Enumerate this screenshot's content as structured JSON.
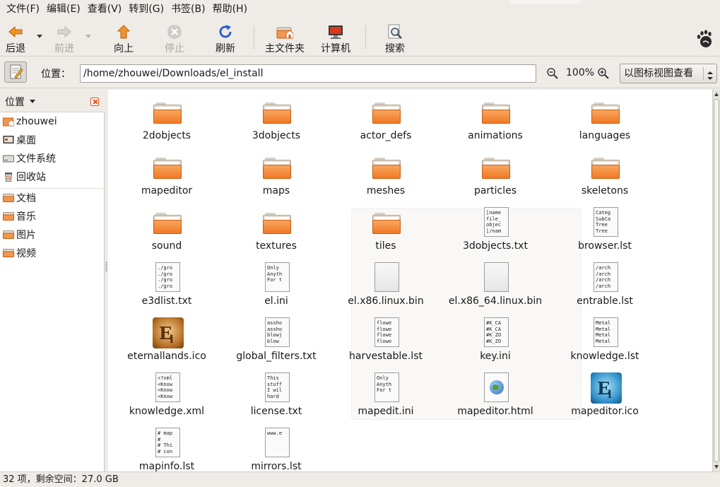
{
  "menubar": {
    "items": [
      "文件(F)",
      "编辑(E)",
      "查看(V)",
      "转到(G)",
      "书签(B)",
      "帮助(H)"
    ]
  },
  "toolbar": {
    "back": "后退",
    "forward": "前进",
    "up": "向上",
    "stop": "停止",
    "reload": "刷新",
    "home": "主文件夹",
    "computer": "计算机",
    "search": "搜索"
  },
  "location": {
    "label": "位置：",
    "path": "/home/zhouwei/Downloads/el_install",
    "zoom": "100%",
    "view_mode": "以图标视图查看"
  },
  "sidebar": {
    "title": "位置",
    "items": [
      {
        "label": "zhouwei",
        "icon": "home-folder-icon"
      },
      {
        "label": "桌面",
        "icon": "desktop-icon"
      },
      {
        "label": "文件系统",
        "icon": "drive-icon"
      },
      {
        "label": "回收站",
        "icon": "trash-icon"
      },
      {
        "label": "文档",
        "icon": "folder-icon"
      },
      {
        "label": "音乐",
        "icon": "folder-icon"
      },
      {
        "label": "图片",
        "icon": "folder-icon"
      },
      {
        "label": "视频",
        "icon": "folder-icon"
      }
    ]
  },
  "files": [
    {
      "name": "2dobjects",
      "kind": "folder"
    },
    {
      "name": "3dobjects",
      "kind": "folder"
    },
    {
      "name": "actor_defs",
      "kind": "folder"
    },
    {
      "name": "animations",
      "kind": "folder"
    },
    {
      "name": "languages",
      "kind": "folder"
    },
    {
      "name": "mapeditor",
      "kind": "folder"
    },
    {
      "name": "maps",
      "kind": "folder"
    },
    {
      "name": "meshes",
      "kind": "folder"
    },
    {
      "name": "particles",
      "kind": "folder"
    },
    {
      "name": "skeletons",
      "kind": "folder"
    },
    {
      "name": "sound",
      "kind": "folder"
    },
    {
      "name": "textures",
      "kind": "folder"
    },
    {
      "name": "tiles",
      "kind": "folder"
    },
    {
      "name": "3dobjects.txt",
      "kind": "text",
      "preview": "[name\nfile_\nobjec\n[/nam"
    },
    {
      "name": "browser.lst",
      "kind": "text",
      "preview": "Categ\nSubCa\nTree\nTree"
    },
    {
      "name": "e3dlist.txt",
      "kind": "text",
      "preview": "./gro\n./gro\n./gro\n./gro"
    },
    {
      "name": "el.ini",
      "kind": "text",
      "preview": "Only\nAnyth\nFor t"
    },
    {
      "name": "el.x86.linux.bin",
      "kind": "binary"
    },
    {
      "name": "el.x86_64.linux.bin",
      "kind": "binary"
    },
    {
      "name": "entrable.lst",
      "kind": "text",
      "preview": "/arch\n/arch\n/arch\n/arch"
    },
    {
      "name": "eternallands.ico",
      "kind": "icon-el-brown"
    },
    {
      "name": "global_filters.txt",
      "kind": "text",
      "preview": "assho\nassho\nblowj\nblow"
    },
    {
      "name": "harvestable.lst",
      "kind": "text",
      "preview": "flowe\nflowe\nflowe\nflowe"
    },
    {
      "name": "key.ini",
      "kind": "text",
      "preview": "#K_CA\n#K_CA\n#K_ZO\n#K_ZO"
    },
    {
      "name": "knowledge.lst",
      "kind": "text",
      "preview": "Metal\nMetal\nMetal\nMetal"
    },
    {
      "name": "knowledge.xml",
      "kind": "text",
      "preview": "<?xml\n<Know\n<Know\n<Know"
    },
    {
      "name": "license.txt",
      "kind": "text",
      "preview": "This\nstuff\nI wil\nhard"
    },
    {
      "name": "mapedit.ini",
      "kind": "text",
      "preview": "Only\nAnyth\nFor t"
    },
    {
      "name": "mapeditor.html",
      "kind": "html"
    },
    {
      "name": "mapeditor.ico",
      "kind": "icon-el-blue"
    },
    {
      "name": "mapinfo.lst",
      "kind": "text",
      "preview": "# map\n#\n# Thi\n# con"
    },
    {
      "name": "mirrors.lst",
      "kind": "text",
      "preview": "www.e"
    }
  ],
  "status": "32 项，剩余空间：27.0 GB"
}
